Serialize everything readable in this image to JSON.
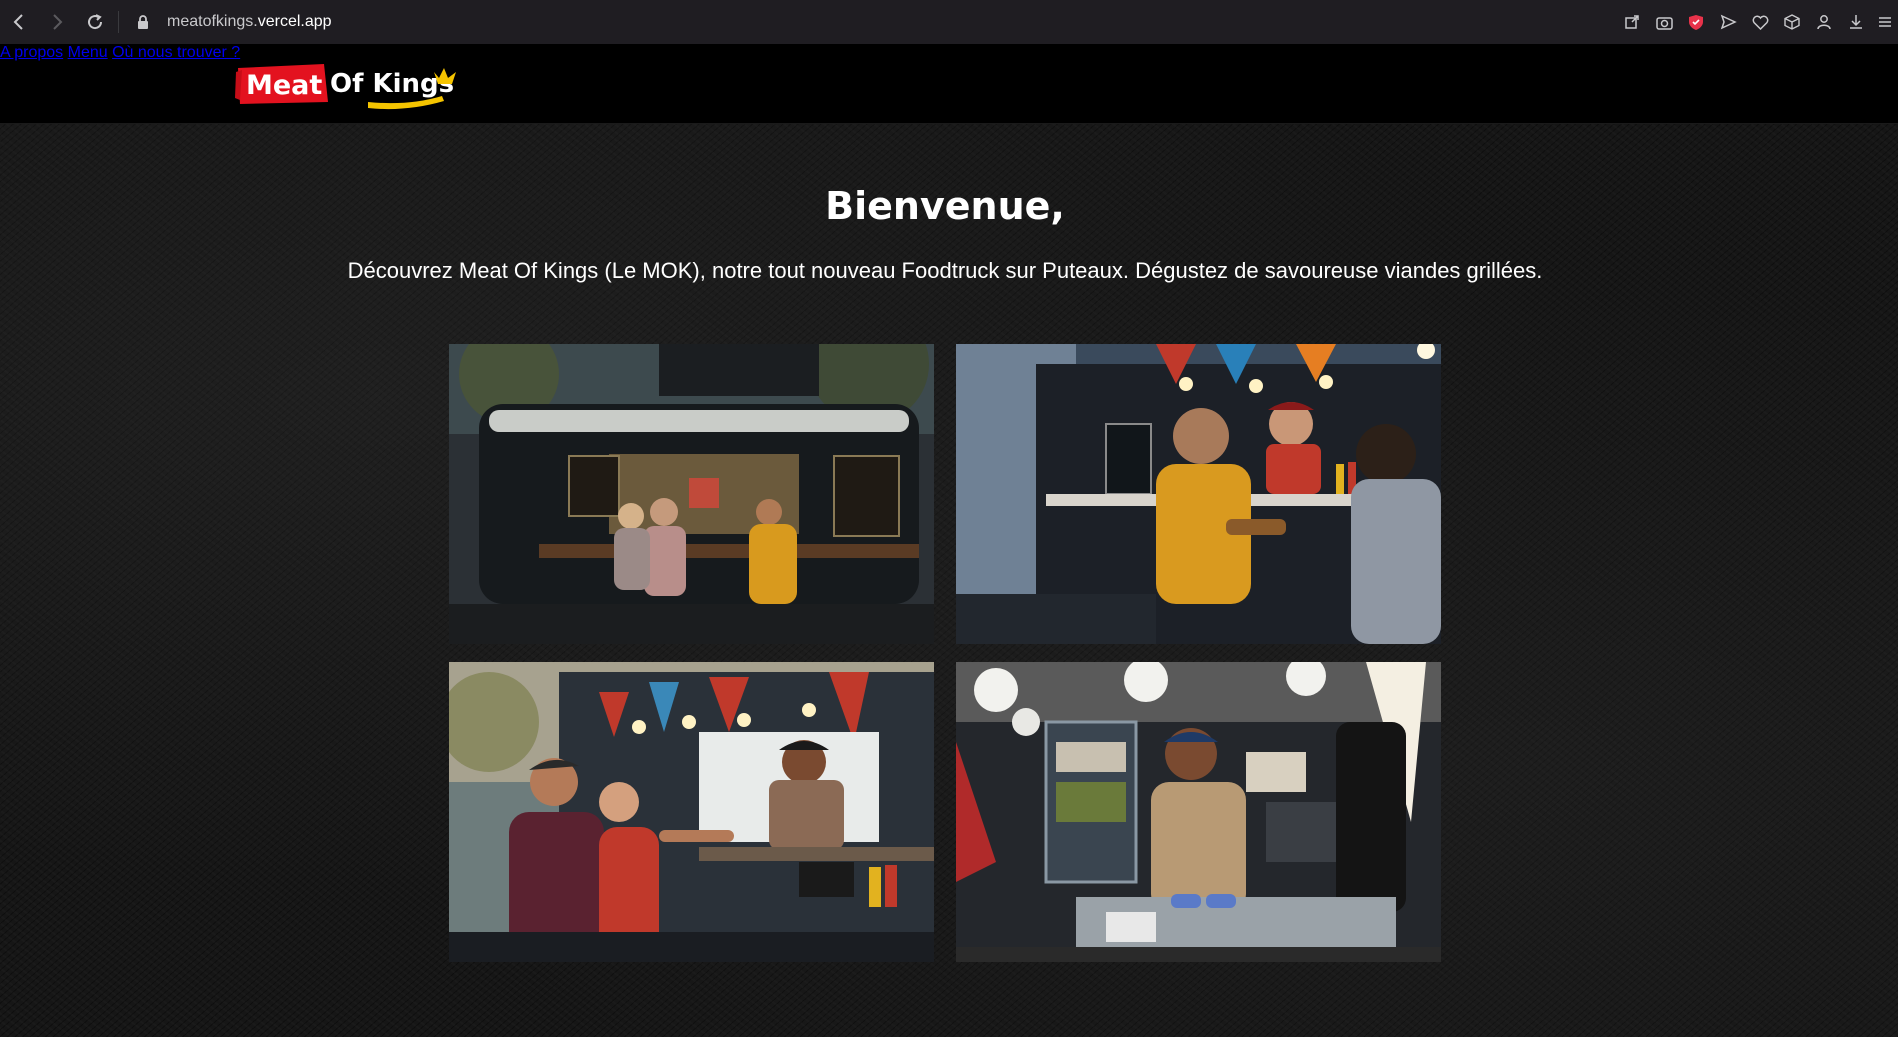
{
  "browser": {
    "url_host": "meatofkings.",
    "url_domain": "vercel.app",
    "icons": [
      "back-icon",
      "forward-icon",
      "reload-icon",
      "lock-icon",
      "share-icon",
      "camera-icon",
      "shield-icon",
      "send-icon",
      "heart-icon",
      "cube-icon",
      "profile-icon",
      "download-icon",
      "menu-icon"
    ]
  },
  "header": {
    "logo_text": "Meat Of Kings",
    "nav": [
      {
        "label": "A propos"
      },
      {
        "label": "Menu"
      },
      {
        "label": "Où nous trouver ?"
      }
    ]
  },
  "main": {
    "title": "Bienvenue,",
    "subtitle": "Découvrez Meat Of Kings (Le MOK), notre tout nouveau Foodtruck sur Puteaux. Dégustez de savoureuse viandes grillées."
  },
  "colors": {
    "logo_red": "#e3121f",
    "logo_yellow": "#f5c400",
    "header_bg": "#000000",
    "page_bg": "#161616"
  }
}
